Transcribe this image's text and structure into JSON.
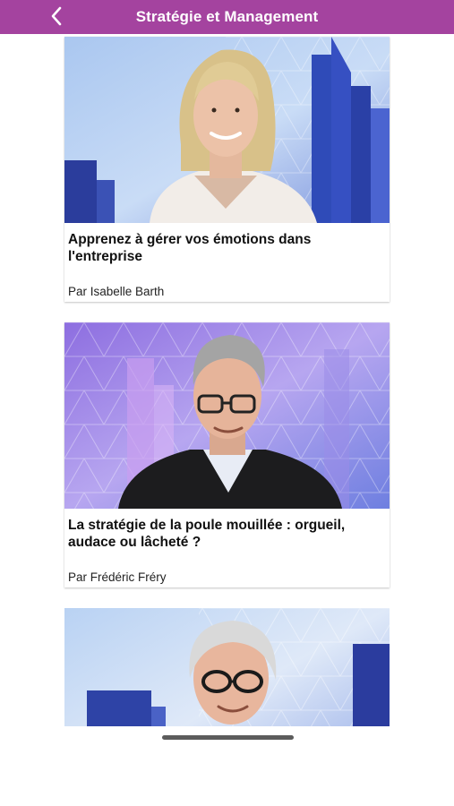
{
  "header": {
    "title": "Stratégie et Management",
    "back_icon": "chevron-left-icon",
    "background": "#a4439f"
  },
  "articles": [
    {
      "title": "Apprenez à gérer vos émotions dans l'entreprise",
      "author": "Par Isabelle Barth"
    },
    {
      "title": "La stratégie de la poule mouillée : orgueil, audace ou lâcheté ?",
      "author": "Par Frédéric Fréry"
    },
    {
      "title": "",
      "author": ""
    }
  ]
}
